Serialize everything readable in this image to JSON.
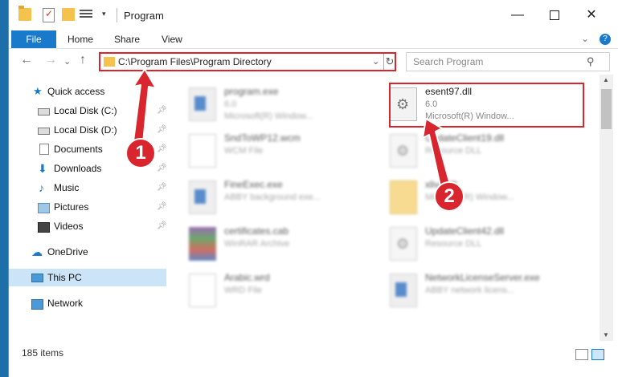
{
  "window": {
    "title": "Program"
  },
  "ribbon": {
    "file": "File",
    "home": "Home",
    "share": "Share",
    "view": "View",
    "help": "?"
  },
  "address": {
    "path": "C:\\Program Files\\Program Directory"
  },
  "search": {
    "placeholder": "Search Program"
  },
  "nav": {
    "quick_access": "Quick access",
    "items": [
      {
        "label": "Local Disk (C:)"
      },
      {
        "label": "Local Disk (D:)"
      },
      {
        "label": "Documents"
      },
      {
        "label": "Downloads"
      },
      {
        "label": "Music"
      },
      {
        "label": "Pictures"
      },
      {
        "label": "Videos"
      }
    ],
    "onedrive": "OneDrive",
    "thispc": "This PC",
    "network": "Network"
  },
  "files": [
    {
      "name": "program.exe",
      "line2": "6.0",
      "line3": "Microsoft(R) Window...",
      "type": "exe"
    },
    {
      "name": "esent97.dll",
      "line2": "6.0",
      "line3": "Microsoft(R) Window...",
      "type": "dll"
    },
    {
      "name": "SndToWP12.wcm",
      "line2": "WCM File",
      "type": "doc"
    },
    {
      "name": "UpdateClient19.dll",
      "line2": "Resource DLL",
      "type": "dll"
    },
    {
      "name": "FineExec.exe",
      "line2": "ABBY background exe...",
      "type": "exe"
    },
    {
      "name": "xlive.dll",
      "line2": "Microsoft(R) Window...",
      "type": "folder"
    },
    {
      "name": "certificates.cab",
      "line2": "WinRAR Archive",
      "type": "cab"
    },
    {
      "name": "UpdateClient42.dll",
      "line2": "Resource DLL",
      "type": "dll"
    },
    {
      "name": "Arabic.wrd",
      "line2": "WRD File",
      "type": "doc"
    },
    {
      "name": "NetworkLicenseServer.exe",
      "line2": "ABBY network licens...",
      "type": "exe"
    }
  ],
  "callouts": {
    "one": "1",
    "two": "2"
  },
  "status": {
    "items": "185 items"
  },
  "colors": {
    "accent": "#1979ca",
    "highlight": "#d9262e"
  }
}
